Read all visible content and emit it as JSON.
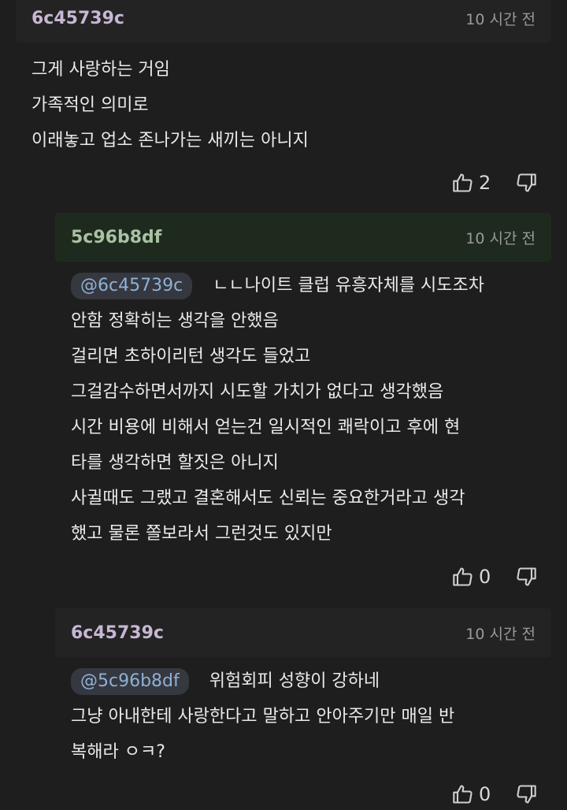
{
  "comments": [
    {
      "author": "6c45739c",
      "author_color": "#c7b6d4",
      "time": "10 시간 전",
      "lines": [
        "그게 사랑하는 거임",
        "가족적인 의미로",
        "이래놓고 업소 존나가는 새끼는 아니지"
      ],
      "likes": "2"
    },
    {
      "author": "5c96b8df",
      "author_color": "#a9c2a3",
      "header_bg": "#1f2a1f",
      "time": "10 시간 전",
      "mention": "@6c45739c",
      "lines": [
        "ㄴㄴ나이트 클럽 유흥자체를 시도조차",
        "안함 정확히는 생각을 안했음",
        "걸리면 초하이리턴 생각도 들었고",
        "그걸감수하면서까지 시도할 가치가 없다고 생각했음",
        "시간 비용에 비해서 얻는건 일시적인 쾌락이고 후에 현",
        "타를 생각하면 할짓은 아니지",
        "사귈때도 그랬고 결혼해서도 신뢰는 중요한거라고 생각",
        "했고 물론 쫄보라서 그런것도 있지만"
      ],
      "likes": "0"
    },
    {
      "author": "6c45739c",
      "author_color": "#c7b6d4",
      "header_bg": "#232323",
      "time": "10 시간 전",
      "mention": "@5c96b8df",
      "lines": [
        "위험회피 성향이 강하네",
        "그냥 아내한테 사랑한다고 말하고 안아주기만 매일 반",
        "복해라 ㅇㅋ?"
      ],
      "likes": "0"
    }
  ],
  "icons": {
    "like": "thumbs-up-icon",
    "dislike": "thumbs-down-icon"
  }
}
